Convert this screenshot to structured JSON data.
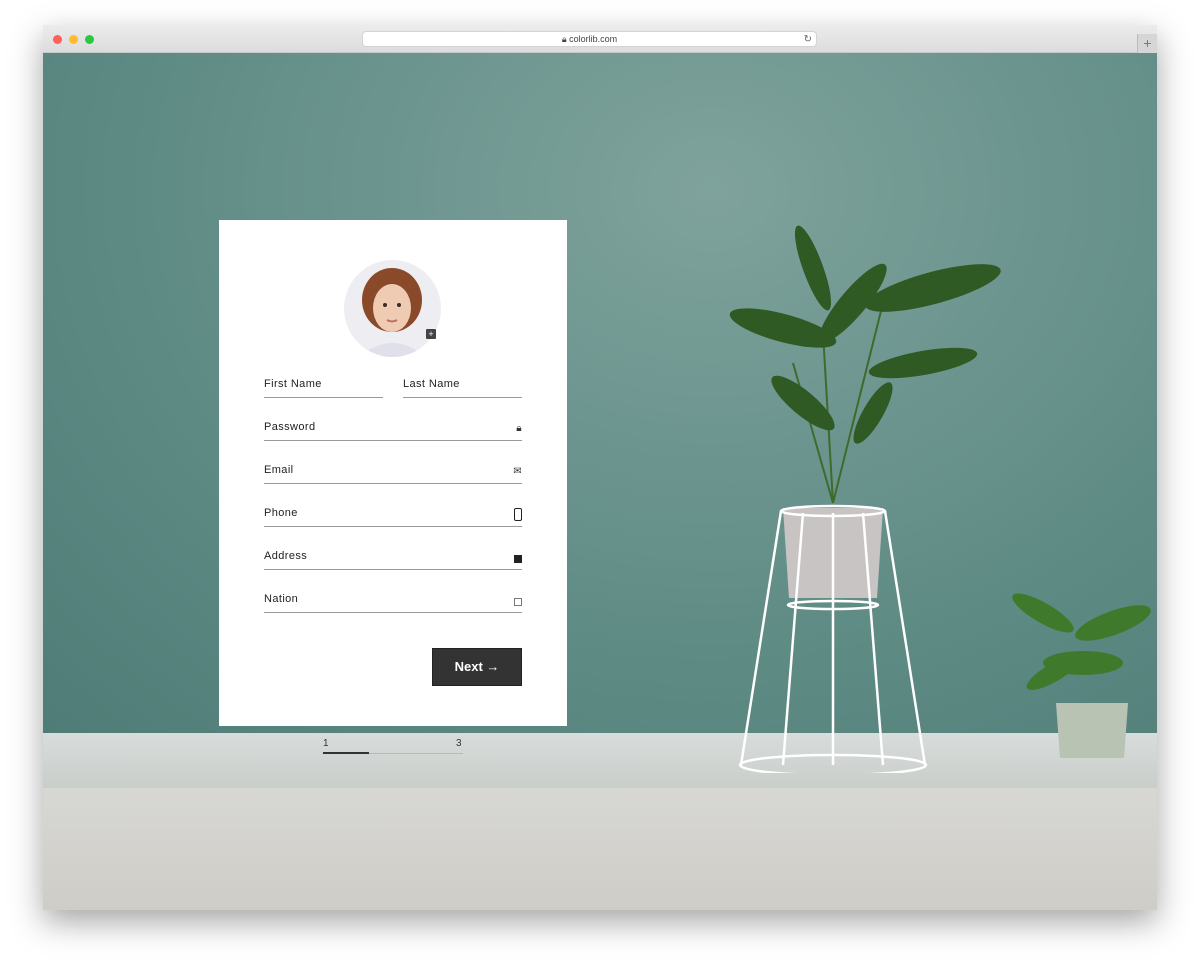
{
  "browser": {
    "url": "colorlib.com",
    "new_tab": "+",
    "traffic_lights": [
      "#fe5f57",
      "#febc2e",
      "#28c840"
    ]
  },
  "form": {
    "fields": [
      {
        "placeholder": "First Name",
        "icon": ""
      },
      {
        "placeholder": "Last Name",
        "icon": ""
      },
      {
        "placeholder": "Password",
        "icon": "lock-icon"
      },
      {
        "placeholder": "Email",
        "icon": "envelope-icon"
      },
      {
        "placeholder": "Phone",
        "icon": "mobile-phone-icon"
      },
      {
        "placeholder": "Address",
        "icon": "map-icon"
      },
      {
        "placeholder": "Nation",
        "icon": "id-card-icon"
      }
    ],
    "next_label": "Next →",
    "add_photo": "+"
  },
  "steps": {
    "current": "1",
    "last": "3",
    "progress": 0.33
  }
}
